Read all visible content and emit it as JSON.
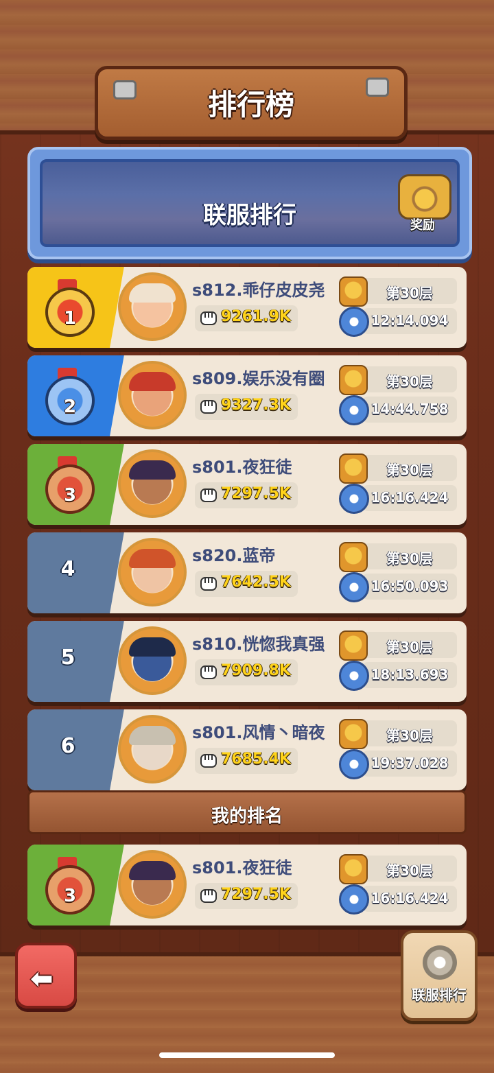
{
  "header": {
    "title": "排行榜"
  },
  "banner": {
    "title": "联服排行",
    "reward_label": "奖励"
  },
  "leaderboard": [
    {
      "rank": "1",
      "rank_style": "gold",
      "medal": true,
      "name": "s812.乖仔皮皮尧",
      "power": "9261.9K",
      "floor": "第30层",
      "time": "12:14.094",
      "avatar_color": "#f5c3a0",
      "hair_color": "#f0e2cf"
    },
    {
      "rank": "2",
      "rank_style": "blue",
      "medal": true,
      "name": "s809.娱乐没有圈",
      "power": "9327.3K",
      "floor": "第30层",
      "time": "14:44.758",
      "avatar_color": "#e9a37a",
      "hair_color": "#c83a2a"
    },
    {
      "rank": "3",
      "rank_style": "green",
      "medal": true,
      "name": "s801.夜狂徒",
      "power": "7297.5K",
      "floor": "第30层",
      "time": "16:16.424",
      "avatar_color": "#b97a52",
      "hair_color": "#3a2a4e"
    },
    {
      "rank": "4",
      "rank_style": "grey",
      "medal": false,
      "name": "s820.蓝帝",
      "power": "7642.5K",
      "floor": "第30层",
      "time": "16:50.093",
      "avatar_color": "#efc4a4",
      "hair_color": "#d0542a"
    },
    {
      "rank": "5",
      "rank_style": "grey",
      "medal": false,
      "name": "s810.恍惚我真强",
      "power": "7909.8K",
      "floor": "第30层",
      "time": "18:13.693",
      "avatar_color": "#3a5a9a",
      "hair_color": "#1e2a4a"
    },
    {
      "rank": "6",
      "rank_style": "grey",
      "medal": false,
      "name": "s801.风情丶暗夜",
      "power": "7685.4K",
      "floor": "第30层",
      "time": "19:37.028",
      "avatar_color": "#e8d8c8",
      "hair_color": "#c8c0b0"
    }
  ],
  "my_rank": {
    "label": "我的排名",
    "entry": {
      "rank": "3",
      "rank_style": "green",
      "medal": true,
      "name": "s801.夜狂徒",
      "power": "7297.5K",
      "floor": "第30层",
      "time": "16:16.424",
      "avatar_color": "#b97a52",
      "hair_color": "#3a2a4e"
    }
  },
  "footer": {
    "back_icon": "arrow-left-icon",
    "server_button_label": "联服排行"
  }
}
